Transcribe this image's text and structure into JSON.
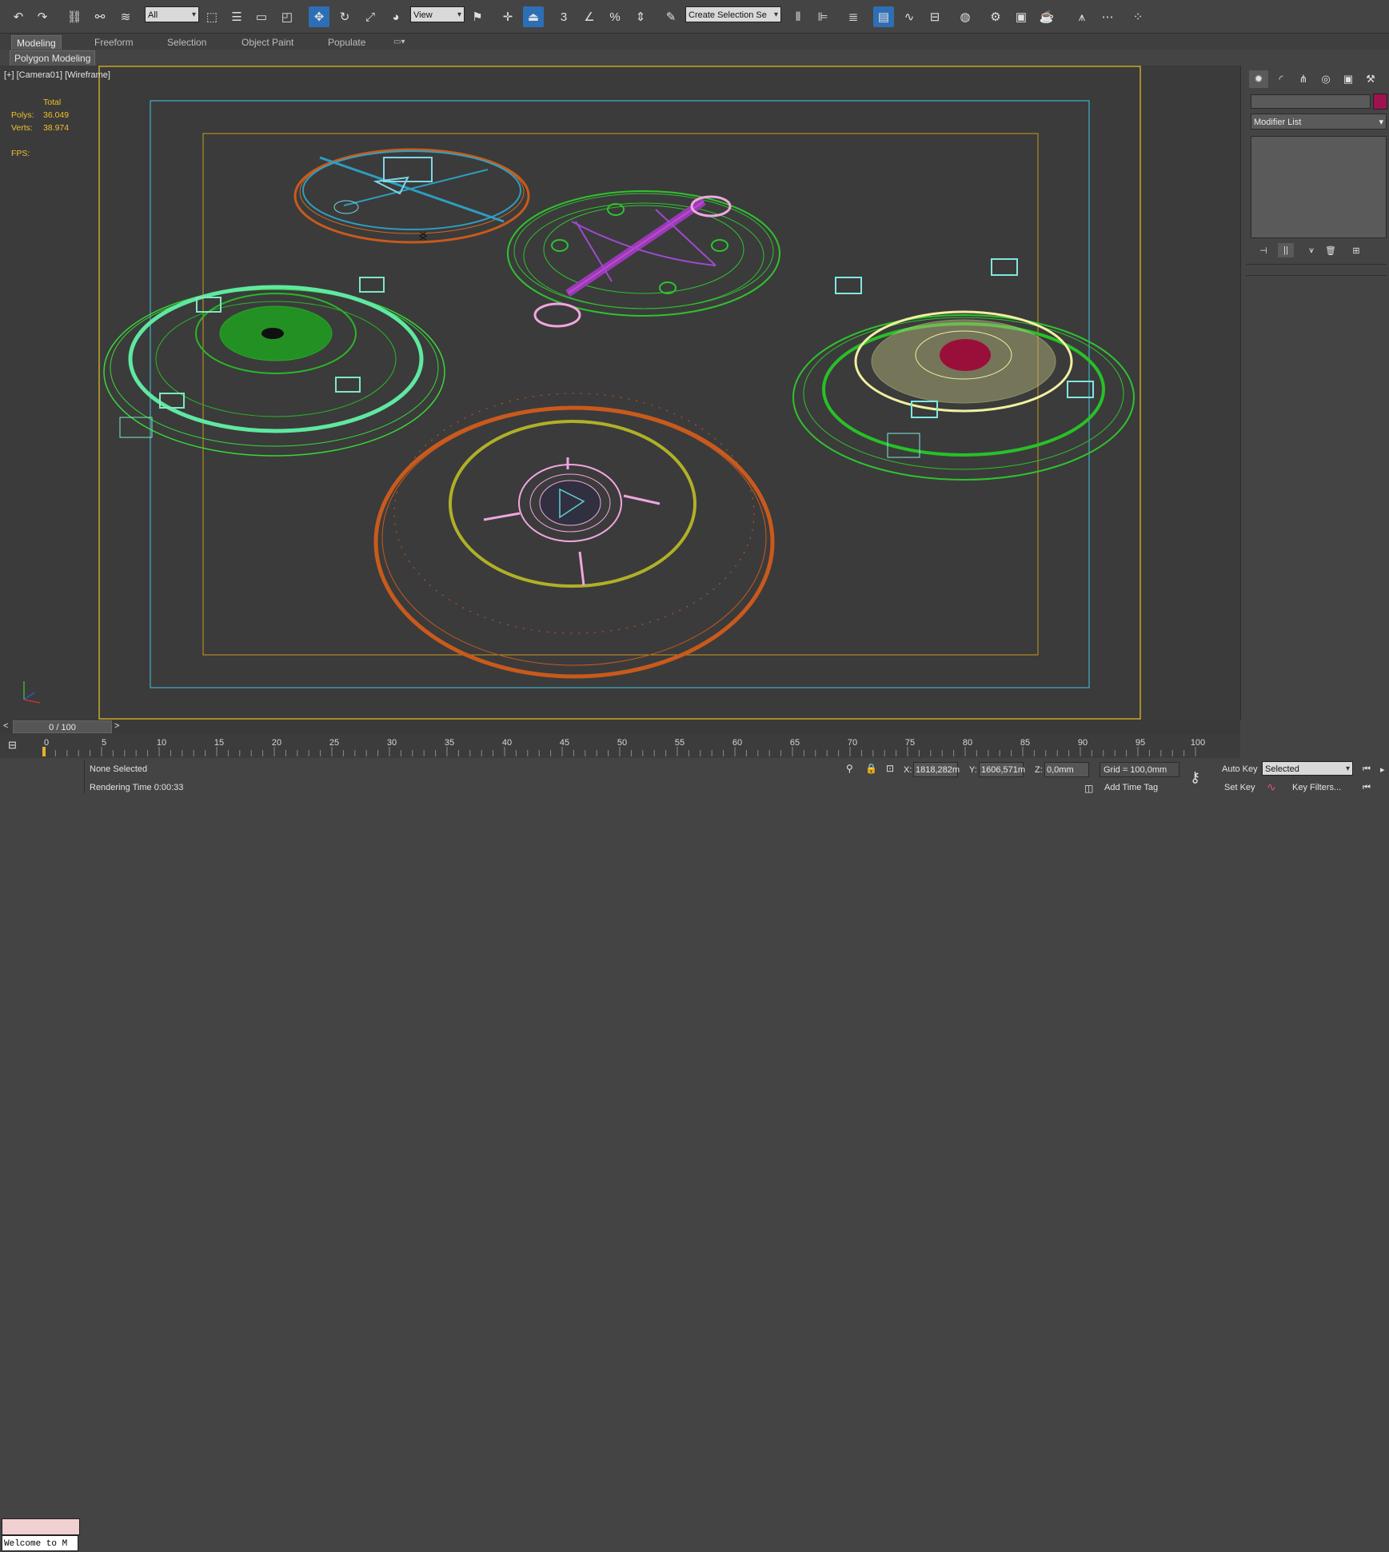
{
  "toolbar": {
    "selection_filter": "All",
    "reference_coord": "View",
    "named_selection": "Create Selection Se"
  },
  "ribbon": {
    "tabs": [
      "Modeling",
      "Freeform",
      "Selection",
      "Object Paint",
      "Populate"
    ],
    "sub_button": "Polygon Modeling"
  },
  "viewport": {
    "label": "[+] [Camera01] [Wireframe]",
    "stats": {
      "header": "Total",
      "polys_label": "Polys:",
      "polys_value": "36.049",
      "verts_label": "Verts:",
      "verts_value": "38.974",
      "fps_label": "FPS:"
    },
    "frame_colors": {
      "camera_safe": "#3fb0c8",
      "render_frame": "#c89a1e",
      "active_border": "#c8a82a"
    }
  },
  "command_panel": {
    "modifier_list": "Modifier List",
    "object_color": "#a0124e"
  },
  "timeline": {
    "slider_label": "0 / 100",
    "ticks": [
      "0",
      "5",
      "10",
      "15",
      "20",
      "25",
      "30",
      "35",
      "40",
      "45",
      "50",
      "55",
      "60",
      "65",
      "70",
      "75",
      "80",
      "85",
      "90",
      "95",
      "100"
    ]
  },
  "status": {
    "selection": "None Selected",
    "rendering": "Rendering Time  0:00:33",
    "x_label": "X:",
    "x_value": "1818,282m",
    "y_label": "Y:",
    "y_value": "1606,571m",
    "z_label": "Z:",
    "z_value": "0,0mm",
    "grid": "Grid = 100,0mm",
    "add_time_tag": "Add Time Tag",
    "auto_key": "Auto Key",
    "set_key": "Set Key",
    "key_mode": "Selected",
    "key_filters": "Key Filters...",
    "maxscript": "Welcome to M"
  }
}
